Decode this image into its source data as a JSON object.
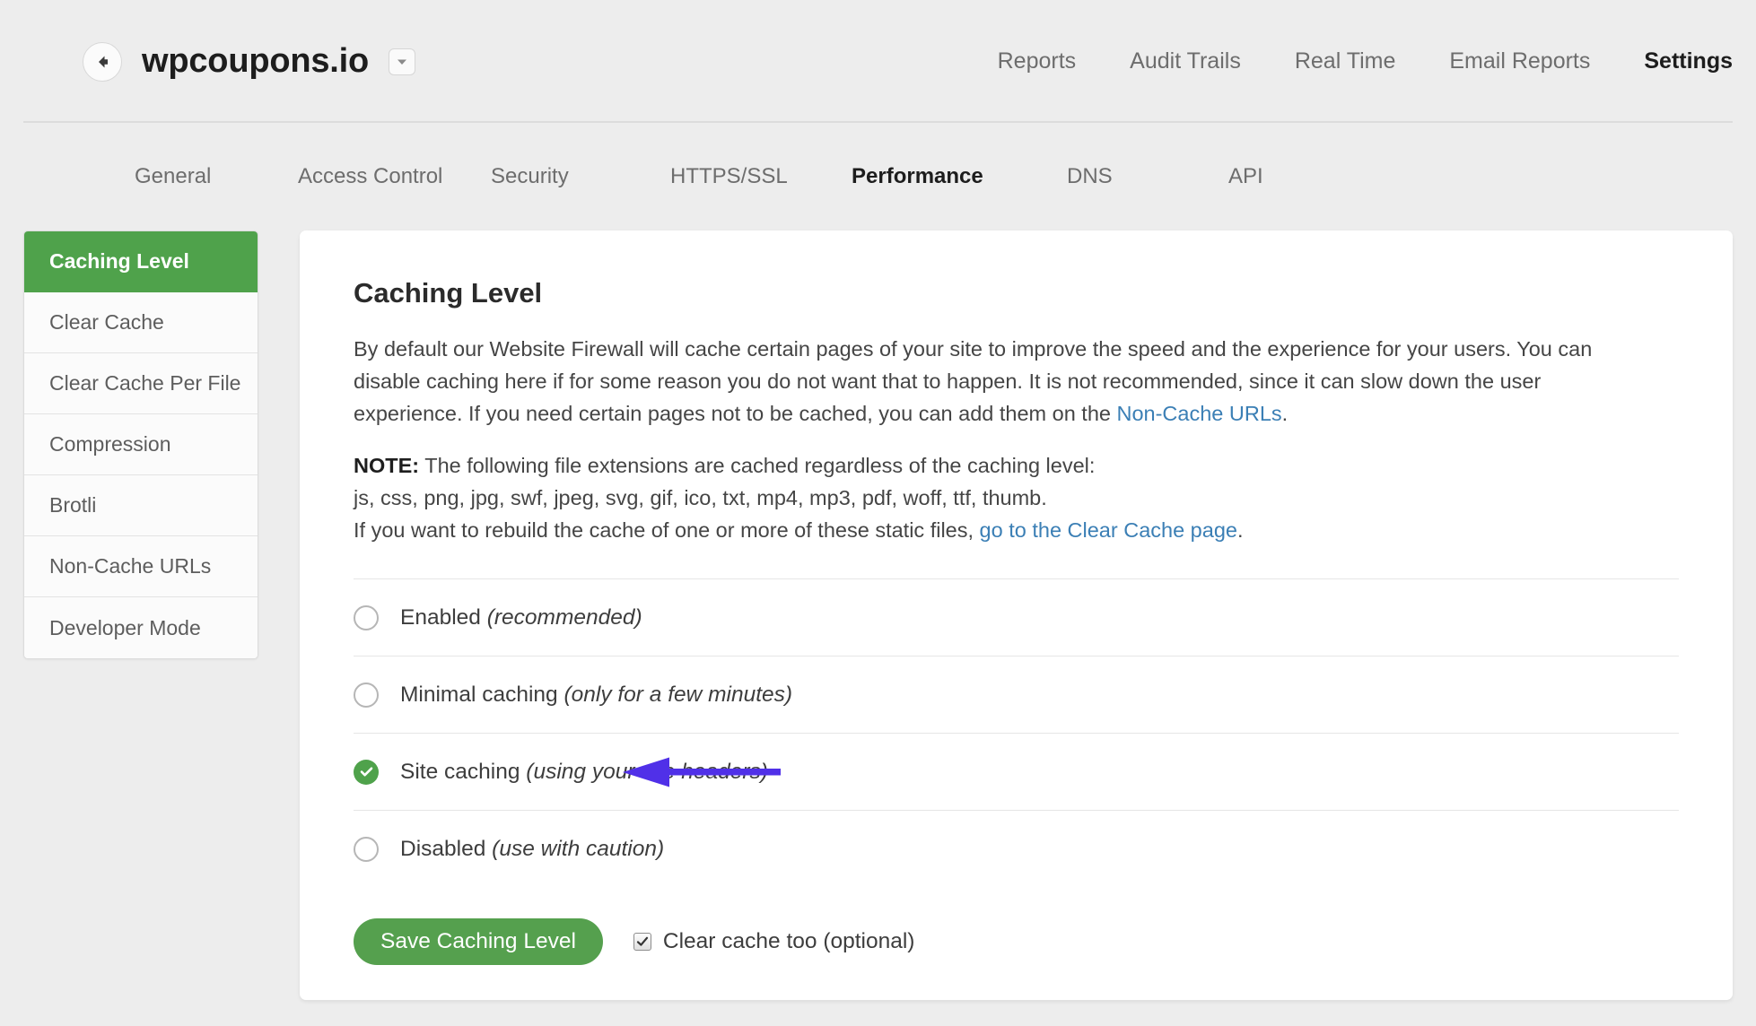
{
  "header": {
    "site_title": "wpcoupons.io",
    "back_icon": "back-arrow-icon",
    "caret_icon": "chevron-down-icon",
    "nav": [
      {
        "label": "Reports",
        "active": false
      },
      {
        "label": "Audit Trails",
        "active": false
      },
      {
        "label": "Real Time",
        "active": false
      },
      {
        "label": "Email Reports",
        "active": false
      },
      {
        "label": "Settings",
        "active": true
      }
    ]
  },
  "subtabs": [
    {
      "label": "General",
      "active": false
    },
    {
      "label": "Access Control",
      "active": false
    },
    {
      "label": "Security",
      "active": false
    },
    {
      "label": "HTTPS/SSL",
      "active": false
    },
    {
      "label": "Performance",
      "active": true
    },
    {
      "label": "DNS",
      "active": false
    },
    {
      "label": "API",
      "active": false
    }
  ],
  "sidebar": {
    "items": [
      {
        "label": "Caching Level",
        "active": true
      },
      {
        "label": "Clear Cache",
        "active": false
      },
      {
        "label": "Clear Cache Per File",
        "active": false
      },
      {
        "label": "Compression",
        "active": false
      },
      {
        "label": "Brotli",
        "active": false
      },
      {
        "label": "Non-Cache URLs",
        "active": false
      },
      {
        "label": "Developer Mode",
        "active": false
      }
    ]
  },
  "content": {
    "title": "Caching Level",
    "paragraph_part1": "By default our Website Firewall will cache certain pages of your site to improve the speed and the experience for your users. You can disable caching here if for some reason you do not want that to happen. It is not recommended, since it can slow down the user experience. If you need certain pages not to be cached, you can add them on the ",
    "paragraph_link": "Non-Cache URLs",
    "paragraph_part2": ".",
    "note_label": "NOTE:",
    "note_text": " The following file extensions are cached regardless of the caching level:",
    "extensions_line": "js, css, png, jpg, swf, jpeg, svg, gif, ico, txt, mp4, mp3, pdf, woff, ttf, thumb.",
    "rebuild_part1": "If you want to rebuild the cache of one or more of these static files, ",
    "rebuild_link": "go to the Clear Cache page",
    "rebuild_part2": ".",
    "options": [
      {
        "label": "Enabled",
        "hint": "(recommended)",
        "checked": false
      },
      {
        "label": "Minimal caching",
        "hint": "(only for a few minutes)",
        "checked": false
      },
      {
        "label": "Site caching",
        "hint": "(using your site headers)",
        "checked": true
      },
      {
        "label": "Disabled",
        "hint": "(use with caution)",
        "checked": false
      }
    ],
    "save_label": "Save Caching Level",
    "clear_cache_checkbox_label": "Clear cache too (optional)",
    "clear_cache_checked": true
  },
  "annotation": {
    "type": "arrow-left",
    "color": "#5030e8",
    "points_at": "Site caching (using your site headers)"
  },
  "colors": {
    "page_bg": "#ededed",
    "accent_green": "#4fa24b",
    "button_green": "#55a04e",
    "link_blue": "#3b7fb5",
    "annotation_purple": "#5030e8"
  }
}
